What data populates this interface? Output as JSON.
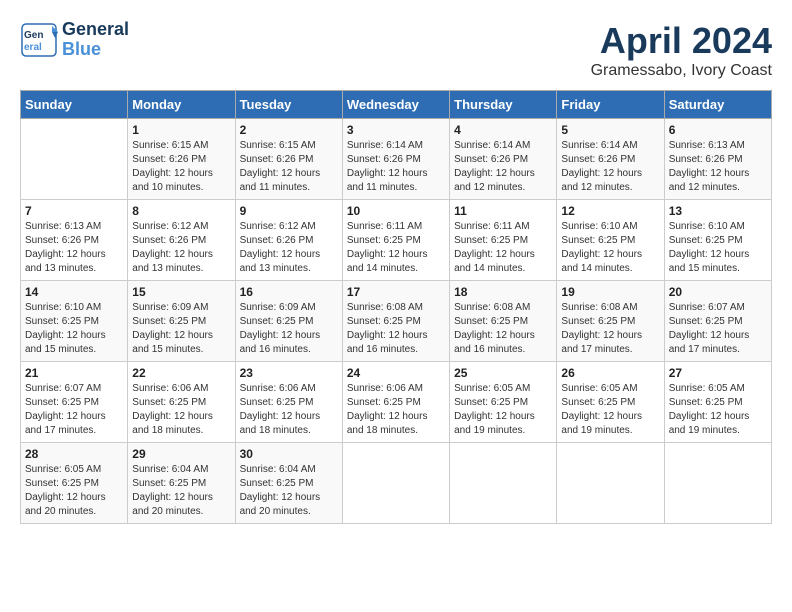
{
  "logo": {
    "line1": "General",
    "line2": "Blue"
  },
  "title": "April 2024",
  "location": "Gramessabo, Ivory Coast",
  "days_header": [
    "Sunday",
    "Monday",
    "Tuesday",
    "Wednesday",
    "Thursday",
    "Friday",
    "Saturday"
  ],
  "weeks": [
    [
      {
        "num": "",
        "info": ""
      },
      {
        "num": "1",
        "info": "Sunrise: 6:15 AM\nSunset: 6:26 PM\nDaylight: 12 hours\nand 10 minutes."
      },
      {
        "num": "2",
        "info": "Sunrise: 6:15 AM\nSunset: 6:26 PM\nDaylight: 12 hours\nand 11 minutes."
      },
      {
        "num": "3",
        "info": "Sunrise: 6:14 AM\nSunset: 6:26 PM\nDaylight: 12 hours\nand 11 minutes."
      },
      {
        "num": "4",
        "info": "Sunrise: 6:14 AM\nSunset: 6:26 PM\nDaylight: 12 hours\nand 12 minutes."
      },
      {
        "num": "5",
        "info": "Sunrise: 6:14 AM\nSunset: 6:26 PM\nDaylight: 12 hours\nand 12 minutes."
      },
      {
        "num": "6",
        "info": "Sunrise: 6:13 AM\nSunset: 6:26 PM\nDaylight: 12 hours\nand 12 minutes."
      }
    ],
    [
      {
        "num": "7",
        "info": "Sunrise: 6:13 AM\nSunset: 6:26 PM\nDaylight: 12 hours\nand 13 minutes."
      },
      {
        "num": "8",
        "info": "Sunrise: 6:12 AM\nSunset: 6:26 PM\nDaylight: 12 hours\nand 13 minutes."
      },
      {
        "num": "9",
        "info": "Sunrise: 6:12 AM\nSunset: 6:26 PM\nDaylight: 12 hours\nand 13 minutes."
      },
      {
        "num": "10",
        "info": "Sunrise: 6:11 AM\nSunset: 6:25 PM\nDaylight: 12 hours\nand 14 minutes."
      },
      {
        "num": "11",
        "info": "Sunrise: 6:11 AM\nSunset: 6:25 PM\nDaylight: 12 hours\nand 14 minutes."
      },
      {
        "num": "12",
        "info": "Sunrise: 6:10 AM\nSunset: 6:25 PM\nDaylight: 12 hours\nand 14 minutes."
      },
      {
        "num": "13",
        "info": "Sunrise: 6:10 AM\nSunset: 6:25 PM\nDaylight: 12 hours\nand 15 minutes."
      }
    ],
    [
      {
        "num": "14",
        "info": "Sunrise: 6:10 AM\nSunset: 6:25 PM\nDaylight: 12 hours\nand 15 minutes."
      },
      {
        "num": "15",
        "info": "Sunrise: 6:09 AM\nSunset: 6:25 PM\nDaylight: 12 hours\nand 15 minutes."
      },
      {
        "num": "16",
        "info": "Sunrise: 6:09 AM\nSunset: 6:25 PM\nDaylight: 12 hours\nand 16 minutes."
      },
      {
        "num": "17",
        "info": "Sunrise: 6:08 AM\nSunset: 6:25 PM\nDaylight: 12 hours\nand 16 minutes."
      },
      {
        "num": "18",
        "info": "Sunrise: 6:08 AM\nSunset: 6:25 PM\nDaylight: 12 hours\nand 16 minutes."
      },
      {
        "num": "19",
        "info": "Sunrise: 6:08 AM\nSunset: 6:25 PM\nDaylight: 12 hours\nand 17 minutes."
      },
      {
        "num": "20",
        "info": "Sunrise: 6:07 AM\nSunset: 6:25 PM\nDaylight: 12 hours\nand 17 minutes."
      }
    ],
    [
      {
        "num": "21",
        "info": "Sunrise: 6:07 AM\nSunset: 6:25 PM\nDaylight: 12 hours\nand 17 minutes."
      },
      {
        "num": "22",
        "info": "Sunrise: 6:06 AM\nSunset: 6:25 PM\nDaylight: 12 hours\nand 18 minutes."
      },
      {
        "num": "23",
        "info": "Sunrise: 6:06 AM\nSunset: 6:25 PM\nDaylight: 12 hours\nand 18 minutes."
      },
      {
        "num": "24",
        "info": "Sunrise: 6:06 AM\nSunset: 6:25 PM\nDaylight: 12 hours\nand 18 minutes."
      },
      {
        "num": "25",
        "info": "Sunrise: 6:05 AM\nSunset: 6:25 PM\nDaylight: 12 hours\nand 19 minutes."
      },
      {
        "num": "26",
        "info": "Sunrise: 6:05 AM\nSunset: 6:25 PM\nDaylight: 12 hours\nand 19 minutes."
      },
      {
        "num": "27",
        "info": "Sunrise: 6:05 AM\nSunset: 6:25 PM\nDaylight: 12 hours\nand 19 minutes."
      }
    ],
    [
      {
        "num": "28",
        "info": "Sunrise: 6:05 AM\nSunset: 6:25 PM\nDaylight: 12 hours\nand 20 minutes."
      },
      {
        "num": "29",
        "info": "Sunrise: 6:04 AM\nSunset: 6:25 PM\nDaylight: 12 hours\nand 20 minutes."
      },
      {
        "num": "30",
        "info": "Sunrise: 6:04 AM\nSunset: 6:25 PM\nDaylight: 12 hours\nand 20 minutes."
      },
      {
        "num": "",
        "info": ""
      },
      {
        "num": "",
        "info": ""
      },
      {
        "num": "",
        "info": ""
      },
      {
        "num": "",
        "info": ""
      }
    ]
  ]
}
